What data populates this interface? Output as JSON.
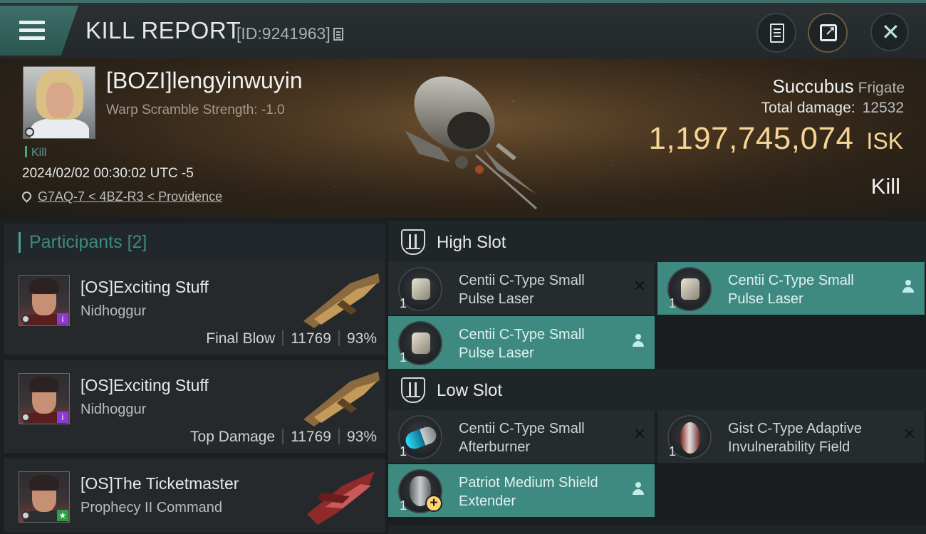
{
  "header": {
    "title": "KILL REPORT",
    "report_id": "[ID:9241963]"
  },
  "victim": {
    "pilot_name": "[BOZI]lengyinwuyin",
    "warp_scramble": "Warp Scramble Strength: -1.0",
    "tag": "Kill",
    "timestamp": "2024/02/02 00:30:02 UTC -5",
    "location": "G7AQ-7 < 4BZ-R3 < Providence",
    "ship_name": "Succubus",
    "ship_class": "Frigate",
    "total_damage_label": "Total damage:",
    "total_damage_value": "12532",
    "isk_value": "1,197,745,074",
    "isk_unit": "ISK",
    "result": "Kill"
  },
  "participants": {
    "label": "Participants",
    "count": "[2]",
    "items": [
      {
        "name": "[OS]Exciting Stuff",
        "ship": "Nidhoggur",
        "role": "Final Blow",
        "damage": "11769",
        "percent": "93%"
      },
      {
        "name": "[OS]Exciting Stuff",
        "ship": "Nidhoggur",
        "role": "Top Damage",
        "damage": "11769",
        "percent": "93%"
      },
      {
        "name": "[OS]The Ticketmaster",
        "ship": "Prophecy II Command"
      }
    ]
  },
  "slots": {
    "high_label": "High Slot",
    "low_label": "Low Slot",
    "high": [
      {
        "name": "Centii C-Type Small Pulse Laser",
        "qty": "1",
        "status": "destroyed"
      },
      {
        "name": "Centii C-Type Small Pulse Laser",
        "qty": "1",
        "status": "dropped"
      },
      {
        "name": "Centii C-Type Small Pulse Laser",
        "qty": "1",
        "status": "dropped"
      }
    ],
    "low": [
      {
        "name": "Centii C-Type Small Afterburner",
        "qty": "1",
        "status": "destroyed"
      },
      {
        "name": "Gist C-Type Adaptive Invulnerability Field",
        "qty": "1",
        "status": "destroyed"
      },
      {
        "name": "Patriot Medium Shield Extender",
        "qty": "1",
        "status": "dropped"
      }
    ]
  },
  "icons": {
    "menu": "hamburger-icon",
    "copy": "copy-icon",
    "doc": "document-icon",
    "share": "share-icon",
    "close": "close-icon",
    "location": "pin-icon",
    "slot": "slot-shield-icon",
    "destroyed": "x-icon",
    "dropped": "person-icon"
  },
  "colors": {
    "accent": "#3f8a80",
    "isk": "#f6d494",
    "participants_label": "#3c8b80"
  }
}
